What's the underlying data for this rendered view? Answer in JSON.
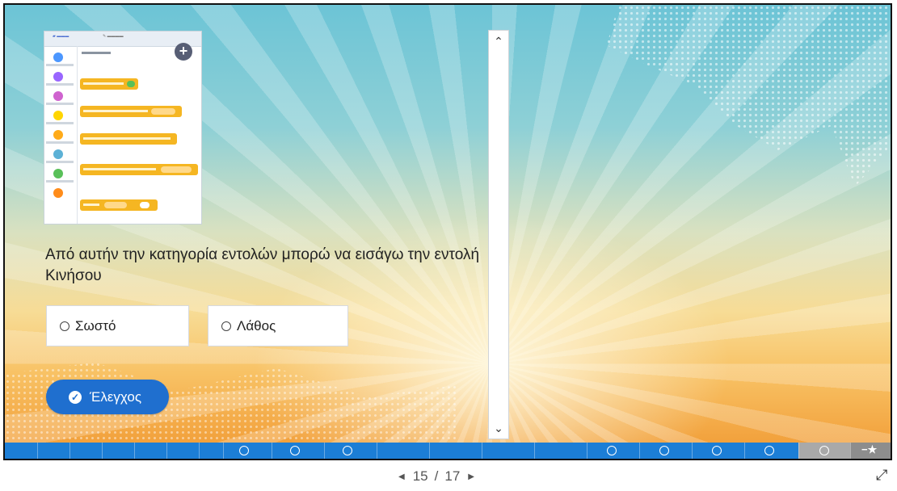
{
  "question": {
    "text": "Από αυτήν την κατηγορία εντολών μπορώ να εισάγω την εντολή Κινήσου"
  },
  "options": [
    {
      "label": "Σωστό"
    },
    {
      "label": "Λάθος"
    }
  ],
  "check_button": {
    "label": "Έλεγχος",
    "icon": "check-circle-icon"
  },
  "scrollbar": {
    "up_icon": "chevron-up-icon",
    "down_icon": "chevron-down-icon"
  },
  "navigation": {
    "current": "15",
    "separator": "/",
    "total": "17",
    "prev_icon": "triangle-left-icon",
    "next_icon": "triangle-right-icon",
    "fullscreen_icon": "expand-arrows-icon"
  },
  "progress": {
    "current_page": 15,
    "total_pages": 17,
    "question_markers": 8,
    "end_icon": "minus-star-icon"
  },
  "colors": {
    "accent": "#1f6fcf",
    "progress_done": "#1c7ed6",
    "progress_rest": "#a9a9a9"
  }
}
